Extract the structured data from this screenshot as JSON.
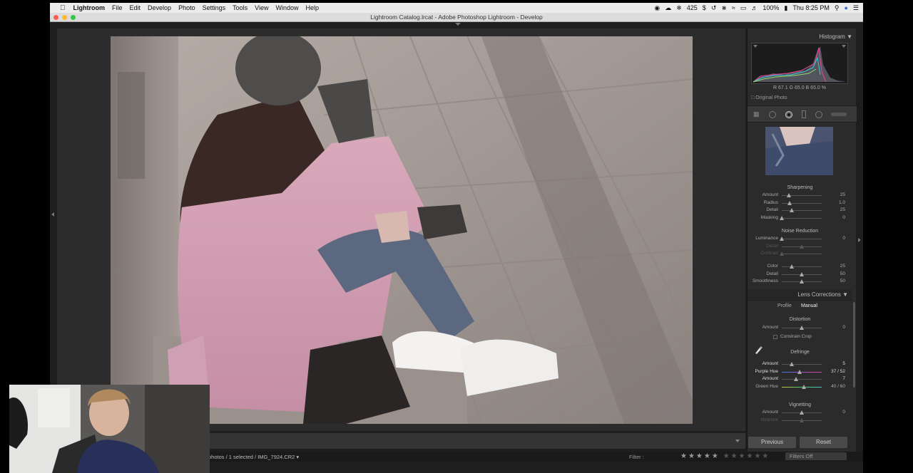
{
  "menubar": {
    "apple": "",
    "items": [
      "Lightroom",
      "File",
      "Edit",
      "Develop",
      "Photo",
      "Settings",
      "Tools",
      "View",
      "Window",
      "Help"
    ],
    "badge_count": "425",
    "battery": "100%",
    "clock": "Thu 8:25 PM"
  },
  "window": {
    "title": "Lightroom Catalog.lrcat - Adobe Photoshop Lightroom - Develop"
  },
  "histogram": {
    "title": "Histogram",
    "readout": "R  67.1   G  65.0   B  65.0 %",
    "original_photo": "Original Photo"
  },
  "detail": {
    "sharpening": {
      "title": "Sharpening",
      "rows": [
        {
          "label": "Amount",
          "value": "25",
          "pct": 0.17
        },
        {
          "label": "Radius",
          "value": "1.0",
          "pct": 0.2
        },
        {
          "label": "Detail",
          "value": "25",
          "pct": 0.25
        },
        {
          "label": "Masking",
          "value": "0",
          "pct": 0.0
        }
      ]
    },
    "noise": {
      "title": "Noise Reduction",
      "rows": [
        {
          "label": "Luminance",
          "value": "0",
          "pct": 0.0,
          "dim": false
        },
        {
          "label": "Detail",
          "value": "",
          "pct": 0.5,
          "dim": true
        },
        {
          "label": "Contrast",
          "value": "",
          "pct": 0.0,
          "dim": true
        },
        {
          "label": "Color",
          "value": "25",
          "pct": 0.25,
          "dim": false
        },
        {
          "label": "Detail",
          "value": "50",
          "pct": 0.5,
          "dim": false
        },
        {
          "label": "Smoothness",
          "value": "50",
          "pct": 0.5,
          "dim": false
        }
      ]
    }
  },
  "lens": {
    "title": "Lens Corrections",
    "tabs": [
      "Profile",
      "Manual"
    ],
    "distortion_title": "Distortion",
    "distortion_amount": {
      "label": "Amount",
      "value": "0",
      "pct": 0.5
    },
    "constrain_crop": "Constrain Crop",
    "defringe_title": "Defringe",
    "defringe_rows": [
      {
        "label": "Amount",
        "value": "5",
        "pct": 0.25,
        "bright": true
      },
      {
        "label": "Purple Hue",
        "value": "37 / 52",
        "pct": 0.45,
        "bright": true
      },
      {
        "label": "Amount",
        "value": "7",
        "pct": 0.35,
        "bright": true
      },
      {
        "label": "Green Hue",
        "value": "40 / 60",
        "pct": 0.55,
        "bright": false
      }
    ],
    "vignetting_title": "Vignetting",
    "vignetting_rows": [
      {
        "label": "Amount",
        "value": "0",
        "pct": 0.5,
        "dim": false
      },
      {
        "label": "Midpoint",
        "value": "",
        "pct": 0.5,
        "dim": true
      }
    ]
  },
  "buttons": {
    "previous": "Previous",
    "reset": "Reset"
  },
  "filmstrip": {
    "info": "photos / 1 selected / IMG_7924.CR2 ▾",
    "filter_label": "Filter :",
    "filters_off": "Filters Off"
  }
}
